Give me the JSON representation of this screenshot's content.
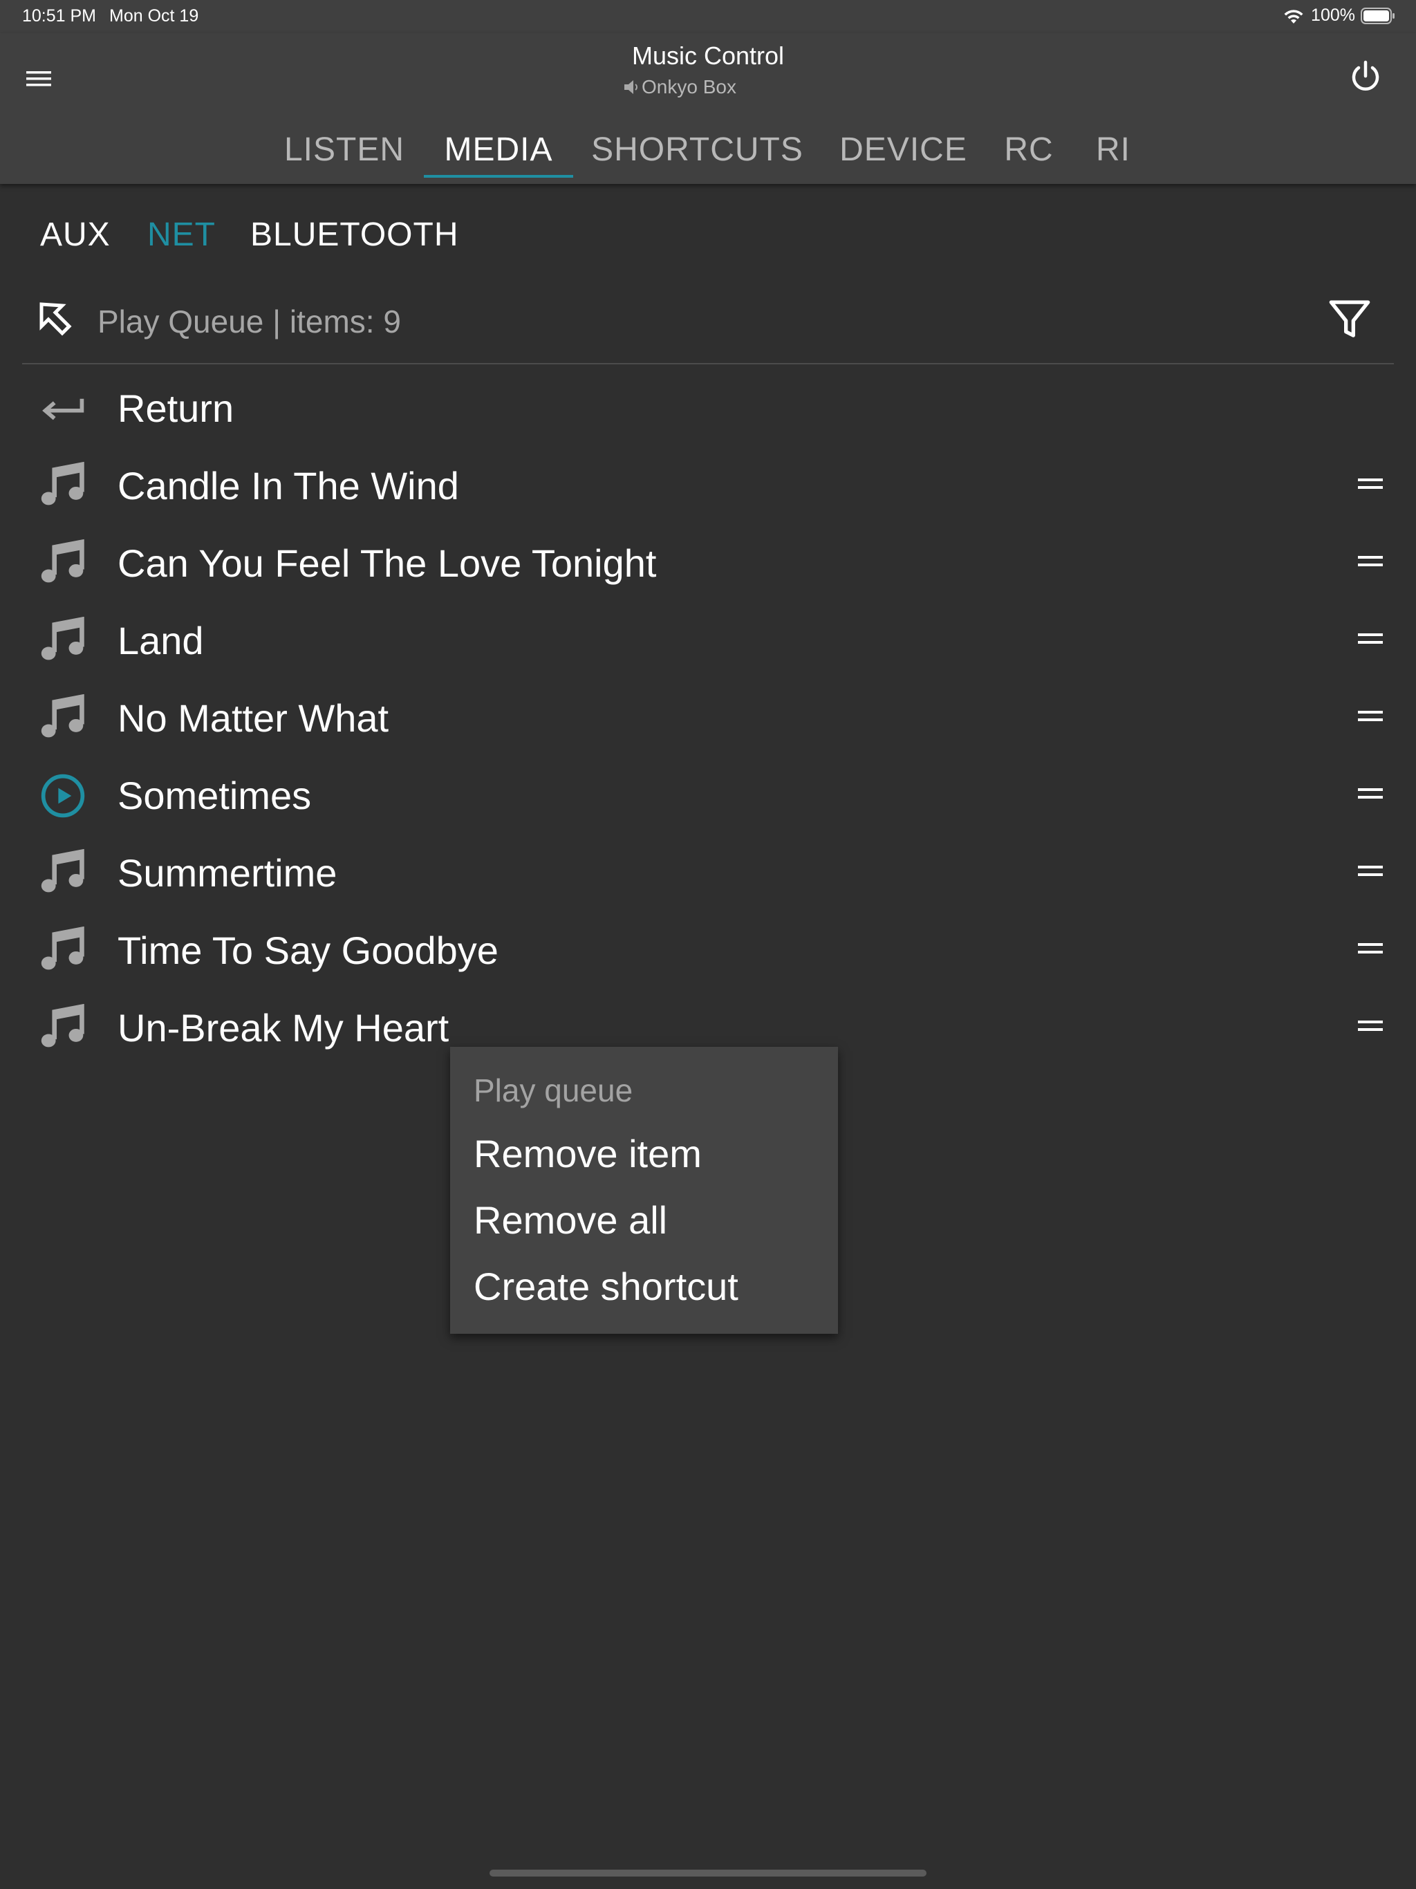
{
  "status_bar": {
    "time": "10:51 PM",
    "date": "Mon Oct 19",
    "battery": "100%"
  },
  "app_bar": {
    "title": "Music Control",
    "subtitle": "Onkyo Box",
    "tabs": [
      {
        "label": "LISTEN",
        "active": false
      },
      {
        "label": "MEDIA",
        "active": true
      },
      {
        "label": "SHORTCUTS",
        "active": false
      },
      {
        "label": "DEVICE",
        "active": false
      },
      {
        "label": "RC",
        "active": false
      },
      {
        "label": "RI",
        "active": false
      }
    ]
  },
  "sources": [
    {
      "label": "AUX",
      "active": false
    },
    {
      "label": "NET",
      "active": true
    },
    {
      "label": "BLUETOOTH",
      "active": false
    }
  ],
  "queue": {
    "title": "Play Queue | items: 9",
    "items": [
      {
        "label": "Return",
        "icon": "return-arrow-icon",
        "draggable": false
      },
      {
        "label": "Candle In The Wind",
        "icon": "music-note-icon",
        "draggable": true
      },
      {
        "label": "Can You Feel The Love Tonight",
        "icon": "music-note-icon",
        "draggable": true
      },
      {
        "label": "Land",
        "icon": "music-note-icon",
        "draggable": true
      },
      {
        "label": "No Matter What",
        "icon": "music-note-icon",
        "draggable": true
      },
      {
        "label": "Sometimes",
        "icon": "play-circle-icon",
        "draggable": true
      },
      {
        "label": "Summertime",
        "icon": "music-note-icon",
        "draggable": true
      },
      {
        "label": "Time To Say Goodbye",
        "icon": "music-note-icon",
        "draggable": true
      },
      {
        "label": "Un-Break My Heart",
        "icon": "music-note-icon",
        "draggable": true
      }
    ]
  },
  "context_menu": {
    "header": "Play queue",
    "items": [
      {
        "label": "Remove item"
      },
      {
        "label": "Remove all"
      },
      {
        "label": "Create shortcut"
      }
    ]
  },
  "colors": {
    "background": "#2f2f2f",
    "app_bar": "#404040",
    "accent": "#1f8fa2",
    "menu": "#444444",
    "icon_gray": "#a8a8a8"
  }
}
